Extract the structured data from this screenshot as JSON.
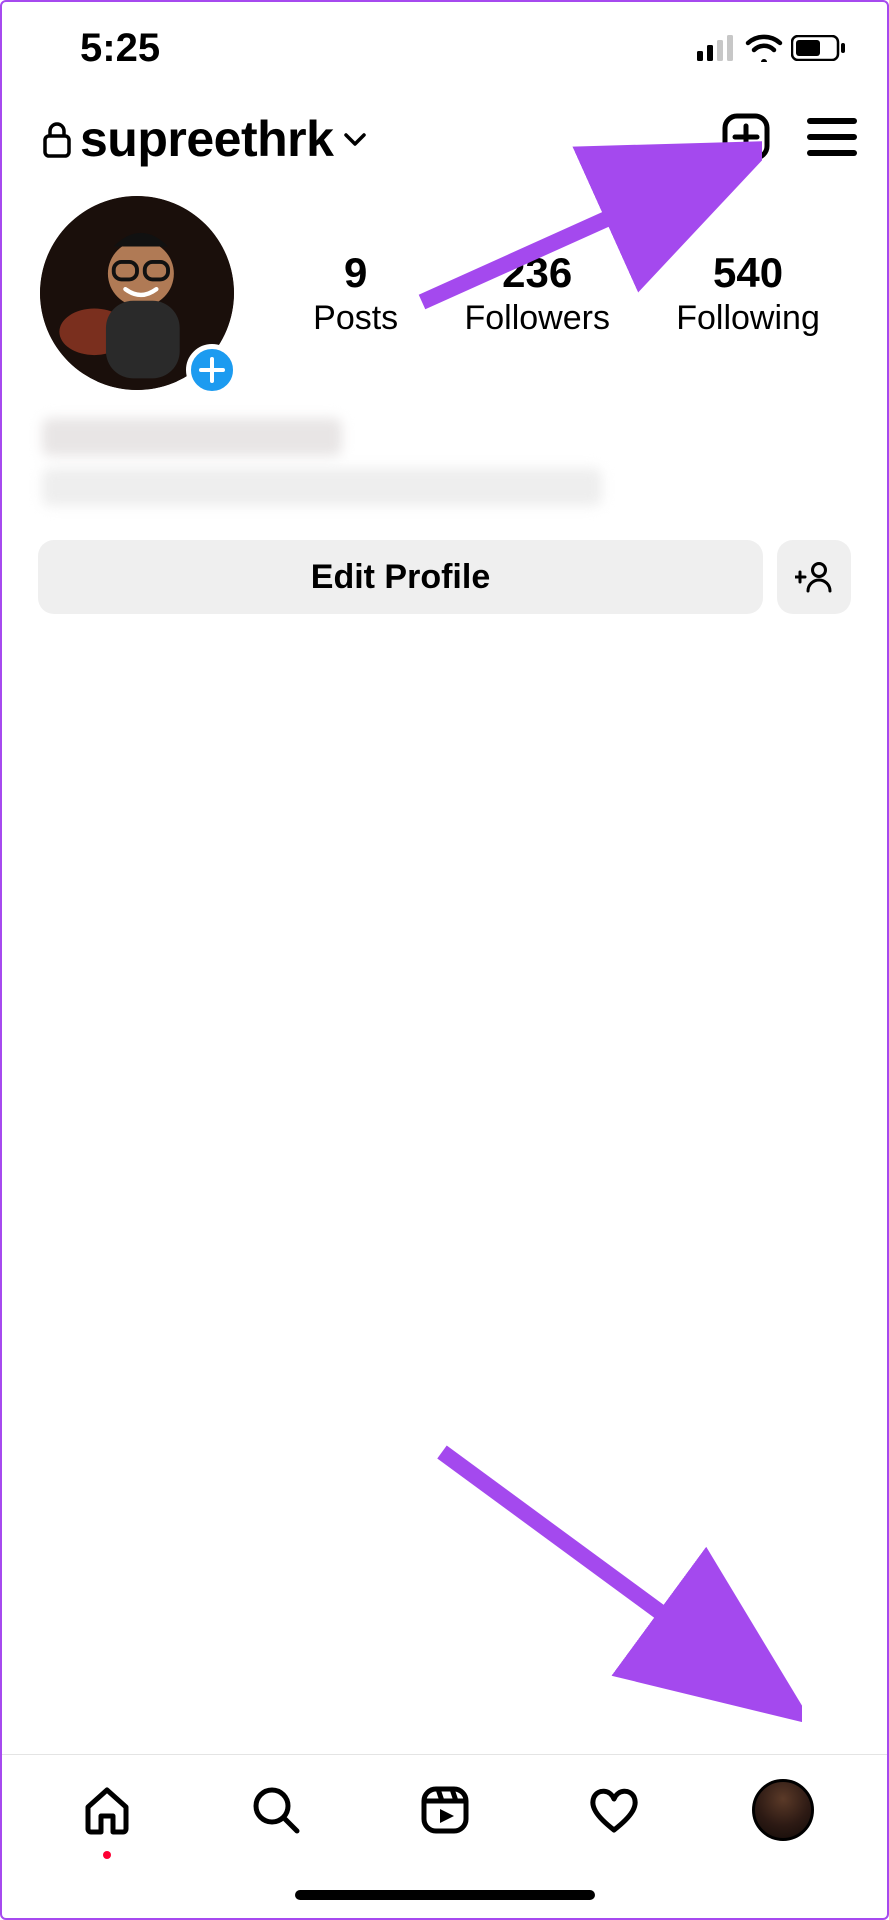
{
  "status": {
    "time": "5:25"
  },
  "header": {
    "username": "supreethrk"
  },
  "stats": {
    "posts": {
      "value": "9",
      "label": "Posts"
    },
    "followers": {
      "value": "236",
      "label": "Followers"
    },
    "following": {
      "value": "540",
      "label": "Following"
    }
  },
  "actions": {
    "edit_profile_label": "Edit Profile"
  },
  "colors": {
    "arrow": "#a449ee",
    "badge": "#1c9bf0"
  }
}
